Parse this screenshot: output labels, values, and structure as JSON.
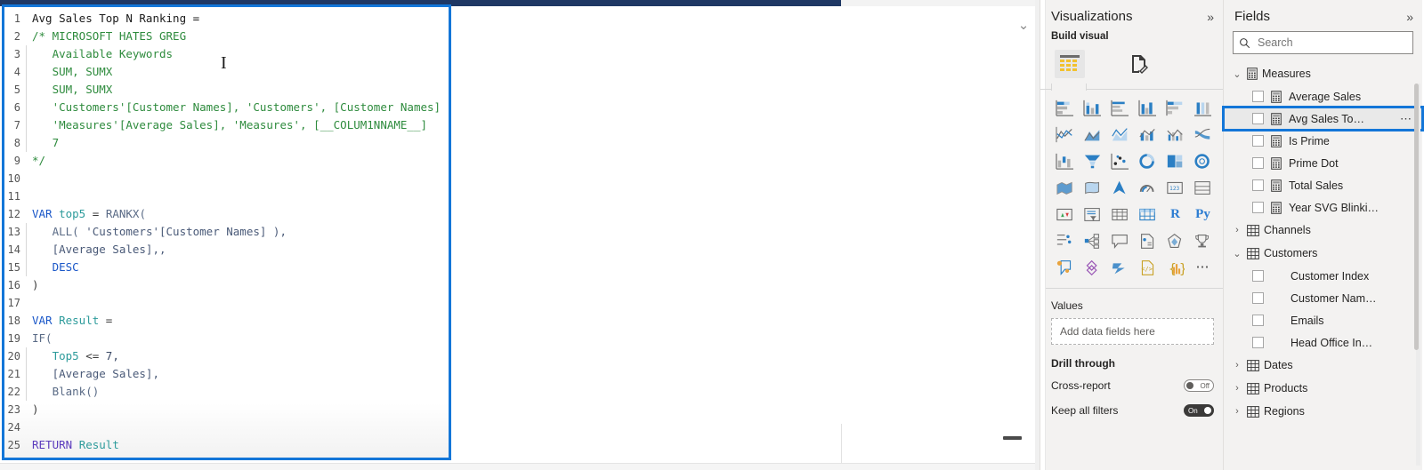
{
  "editor": {
    "lines": [
      {
        "n": "1",
        "indent": false,
        "tokens": [
          {
            "t": "Avg Sales Top N Ranking =",
            "c": "tok-plain"
          }
        ]
      },
      {
        "n": "2",
        "indent": false,
        "tokens": [
          {
            "t": "/* MICROSOFT HATES GREG",
            "c": "tok-comment"
          }
        ]
      },
      {
        "n": "3",
        "indent": true,
        "tokens": [
          {
            "t": "   Available Keywords",
            "c": "tok-comment"
          }
        ]
      },
      {
        "n": "4",
        "indent": true,
        "tokens": [
          {
            "t": "   SUM, SUMX",
            "c": "tok-comment"
          }
        ]
      },
      {
        "n": "5",
        "indent": true,
        "tokens": [
          {
            "t": "   SUM, SUMX",
            "c": "tok-comment"
          }
        ]
      },
      {
        "n": "6",
        "indent": true,
        "tokens": [
          {
            "t": "   'Customers'[Customer Names], 'Customers', [Customer Names]",
            "c": "tok-comment"
          }
        ]
      },
      {
        "n": "7",
        "indent": true,
        "tokens": [
          {
            "t": "   'Measures'[Average Sales], 'Measures', [__COLUM1NNAME__]",
            "c": "tok-comment"
          }
        ]
      },
      {
        "n": "8",
        "indent": true,
        "tokens": [
          {
            "t": "   7",
            "c": "tok-comment"
          }
        ]
      },
      {
        "n": "9",
        "indent": false,
        "tokens": [
          {
            "t": "*/",
            "c": "tok-comment"
          }
        ]
      },
      {
        "n": "10",
        "indent": false,
        "tokens": []
      },
      {
        "n": "11",
        "indent": false,
        "tokens": []
      },
      {
        "n": "12",
        "indent": false,
        "tokens": [
          {
            "t": "VAR ",
            "c": "tok-kw"
          },
          {
            "t": "top5 ",
            "c": "tok-var"
          },
          {
            "t": "= ",
            "c": "tok-op"
          },
          {
            "t": "RANKX(",
            "c": "tok-fn"
          }
        ]
      },
      {
        "n": "13",
        "indent": true,
        "tokens": [
          {
            "t": "   ALL( ",
            "c": "tok-fn"
          },
          {
            "t": "'Customers'[Customer Names] ),",
            "c": "tok-ref"
          }
        ]
      },
      {
        "n": "14",
        "indent": true,
        "tokens": [
          {
            "t": "   [Average Sales],,",
            "c": "tok-ref"
          }
        ]
      },
      {
        "n": "15",
        "indent": true,
        "tokens": [
          {
            "t": "   DESC",
            "c": "tok-kw"
          }
        ]
      },
      {
        "n": "16",
        "indent": false,
        "tokens": [
          {
            "t": ")",
            "c": "tok-op"
          }
        ]
      },
      {
        "n": "17",
        "indent": false,
        "tokens": []
      },
      {
        "n": "18",
        "indent": false,
        "tokens": [
          {
            "t": "VAR ",
            "c": "tok-kw"
          },
          {
            "t": "Result ",
            "c": "tok-var"
          },
          {
            "t": "=",
            "c": "tok-op"
          }
        ]
      },
      {
        "n": "19",
        "indent": false,
        "tokens": [
          {
            "t": "IF(",
            "c": "tok-fn"
          }
        ]
      },
      {
        "n": "20",
        "indent": true,
        "tokens": [
          {
            "t": "   Top5 ",
            "c": "tok-var"
          },
          {
            "t": "<= ",
            "c": "tok-op"
          },
          {
            "t": "7,",
            "c": "tok-num"
          }
        ]
      },
      {
        "n": "21",
        "indent": true,
        "tokens": [
          {
            "t": "   [Average Sales],",
            "c": "tok-ref"
          }
        ]
      },
      {
        "n": "22",
        "indent": true,
        "tokens": [
          {
            "t": "   Blank()",
            "c": "tok-fn"
          }
        ]
      },
      {
        "n": "23",
        "indent": false,
        "tokens": [
          {
            "t": ")",
            "c": "tok-op"
          }
        ]
      },
      {
        "n": "24",
        "indent": false,
        "tokens": []
      },
      {
        "n": "25",
        "indent": false,
        "tokens": [
          {
            "t": "RETURN ",
            "c": "tok-return"
          },
          {
            "t": "Result",
            "c": "tok-var"
          }
        ]
      }
    ],
    "cursor_glyph": "I",
    "collapse_label": "—",
    "expand_chevron": "⌄"
  },
  "visualizations": {
    "title": "Visualizations",
    "expand_icon": "»",
    "build_visual_label": "Build visual",
    "tabs": [
      {
        "name": "build-fields-tab",
        "active": true
      },
      {
        "name": "format-visual-tab",
        "active": false
      }
    ],
    "icons": [
      "stacked-bar-chart-icon",
      "stacked-column-chart-icon",
      "clustered-bar-chart-icon",
      "clustered-column-chart-icon",
      "hundred-percent-stacked-bar-chart-icon",
      "hundred-percent-stacked-column-chart-icon",
      "line-chart-icon",
      "area-chart-icon",
      "stacked-area-chart-icon",
      "line-and-stacked-column-chart-icon",
      "line-and-clustered-column-chart-icon",
      "ribbon-chart-icon",
      "waterfall-chart-icon",
      "funnel-chart-icon",
      "scatter-chart-icon",
      "pie-chart-icon",
      "treemap-icon",
      "donut-chart-icon",
      "map-icon",
      "filled-map-icon",
      "azure-map-icon",
      "gauge-chart-icon",
      "card-icon",
      "multi-row-card-icon",
      "kpi-icon",
      "slicer-icon",
      "table-icon",
      "matrix-icon",
      "r-script-visual-icon",
      "python-visual-icon",
      "decomposition-tree-icon",
      "key-influencers-icon",
      "smart-narrative-icon",
      "paginated-report-icon",
      "power-apps-icon",
      "q-and-a-icon",
      "arcgis-maps-icon",
      "power-automate-icon",
      "zebra-bi-icon",
      "html-content-icon",
      "sparkline-icon",
      "more-visuals-ellipsis-icon"
    ],
    "wells": {
      "values_label": "Values",
      "values_placeholder": "Add data fields here",
      "drill_through_label": "Drill through",
      "cross_report_label": "Cross-report",
      "cross_report_state": "Off",
      "keep_all_filters_label": "Keep all filters",
      "keep_all_filters_state": "On"
    }
  },
  "fields": {
    "title": "Fields",
    "expand_icon": "»",
    "search": {
      "placeholder": "Search",
      "value": ""
    },
    "tree": [
      {
        "name": "Measures",
        "expanded": true,
        "caret": "⌄",
        "icon": "measures-table-icon",
        "children": [
          {
            "label": "Average Sales",
            "icon": "measure-icon",
            "selected": false
          },
          {
            "label": "Avg Sales To…",
            "icon": "measure-icon",
            "selected": true,
            "ellipsis": "⋯"
          },
          {
            "label": "Is Prime",
            "icon": "measure-icon",
            "selected": false
          },
          {
            "label": "Prime Dot",
            "icon": "measure-icon",
            "selected": false
          },
          {
            "label": "Total Sales",
            "icon": "measure-icon",
            "selected": false
          },
          {
            "label": "Year SVG Blinki…",
            "icon": "measure-icon",
            "selected": false
          }
        ]
      },
      {
        "name": "Channels",
        "expanded": false,
        "caret": "›",
        "icon": "table-icon",
        "children": []
      },
      {
        "name": "Customers",
        "expanded": true,
        "caret": "⌄",
        "icon": "table-icon",
        "children": [
          {
            "label": "Customer Index",
            "icon": "",
            "selected": false
          },
          {
            "label": "Customer Nam…",
            "icon": "",
            "selected": false
          },
          {
            "label": "Emails",
            "icon": "",
            "selected": false
          },
          {
            "label": "Head Office In…",
            "icon": "",
            "selected": false
          }
        ]
      },
      {
        "name": "Dates",
        "expanded": false,
        "caret": "›",
        "icon": "table-icon",
        "children": []
      },
      {
        "name": "Products",
        "expanded": false,
        "caret": "›",
        "icon": "table-icon",
        "children": []
      },
      {
        "name": "Regions",
        "expanded": false,
        "caret": "›",
        "icon": "table-icon",
        "children": []
      }
    ]
  },
  "colors": {
    "selection_blue": "#1376d8",
    "panel_bg": "#f3f2f1",
    "scrollbar_dark": "#1f3864",
    "accent_icon_blue": "#2d7dd2"
  }
}
